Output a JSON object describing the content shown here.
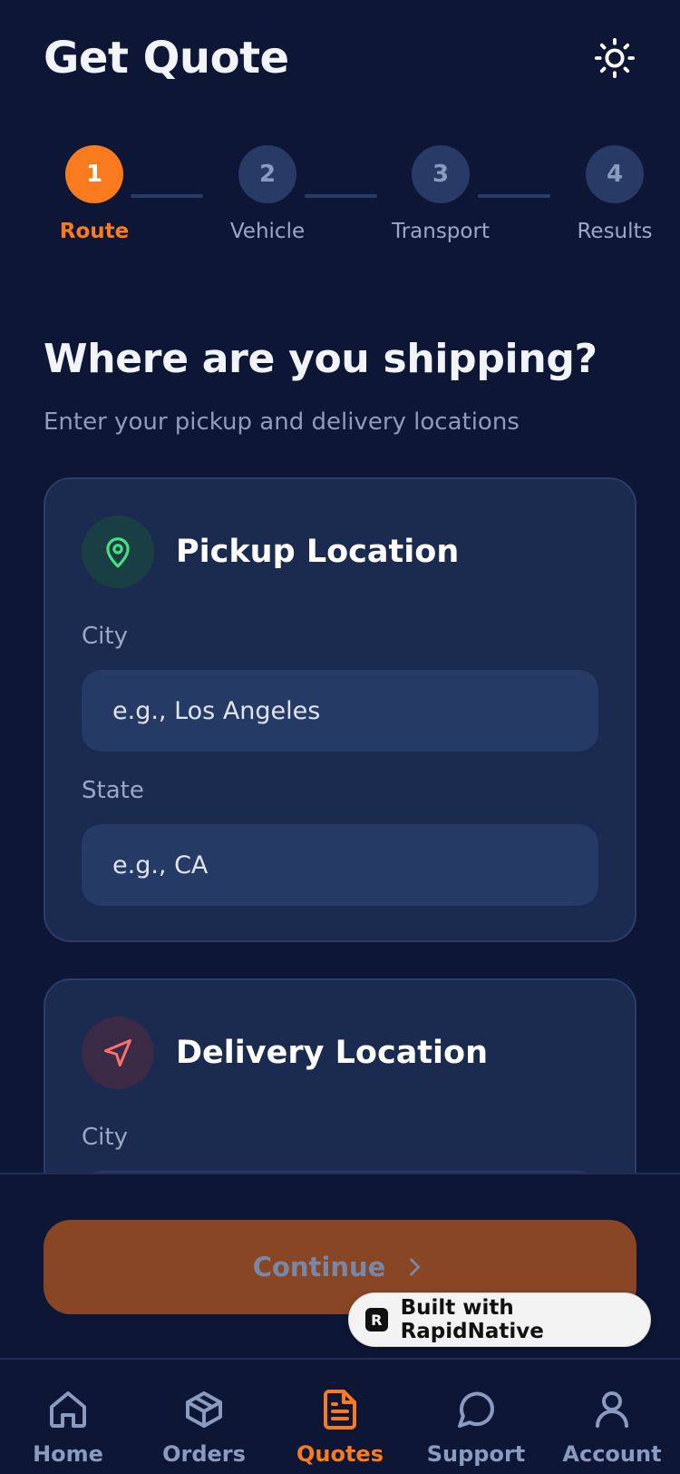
{
  "header": {
    "title": "Get Quote",
    "theme_icon": "sun-icon"
  },
  "stepper": {
    "current": 1,
    "steps": [
      {
        "number": "1",
        "label": "Route"
      },
      {
        "number": "2",
        "label": "Vehicle"
      },
      {
        "number": "3",
        "label": "Transport"
      },
      {
        "number": "4",
        "label": "Results"
      }
    ]
  },
  "main": {
    "heading": "Where are you shipping?",
    "subheading": "Enter your pickup and delivery locations"
  },
  "pickup": {
    "title": "Pickup Location",
    "icon": "map-pin-icon",
    "city_label": "City",
    "city_placeholder": "e.g., Los Angeles",
    "state_label": "State",
    "state_placeholder": "e.g., CA"
  },
  "delivery": {
    "title": "Delivery Location",
    "icon": "navigation-arrow-icon",
    "city_label": "City"
  },
  "actions": {
    "continue_label": "Continue"
  },
  "badge": {
    "label": "Built with RapidNative"
  },
  "tabbar": {
    "active": "Quotes",
    "items": [
      {
        "label": "Home",
        "icon": "home-icon"
      },
      {
        "label": "Orders",
        "icon": "box-icon"
      },
      {
        "label": "Quotes",
        "icon": "document-icon"
      },
      {
        "label": "Support",
        "icon": "chat-bubble-icon"
      },
      {
        "label": "Account",
        "icon": "user-icon"
      }
    ]
  },
  "colors": {
    "background": "#0d1735",
    "card": "#1b2a4f",
    "accent": "#f97b1e",
    "input": "#263a66",
    "pickup_icon": "#4ade80",
    "delivery_icon": "#f87171"
  }
}
